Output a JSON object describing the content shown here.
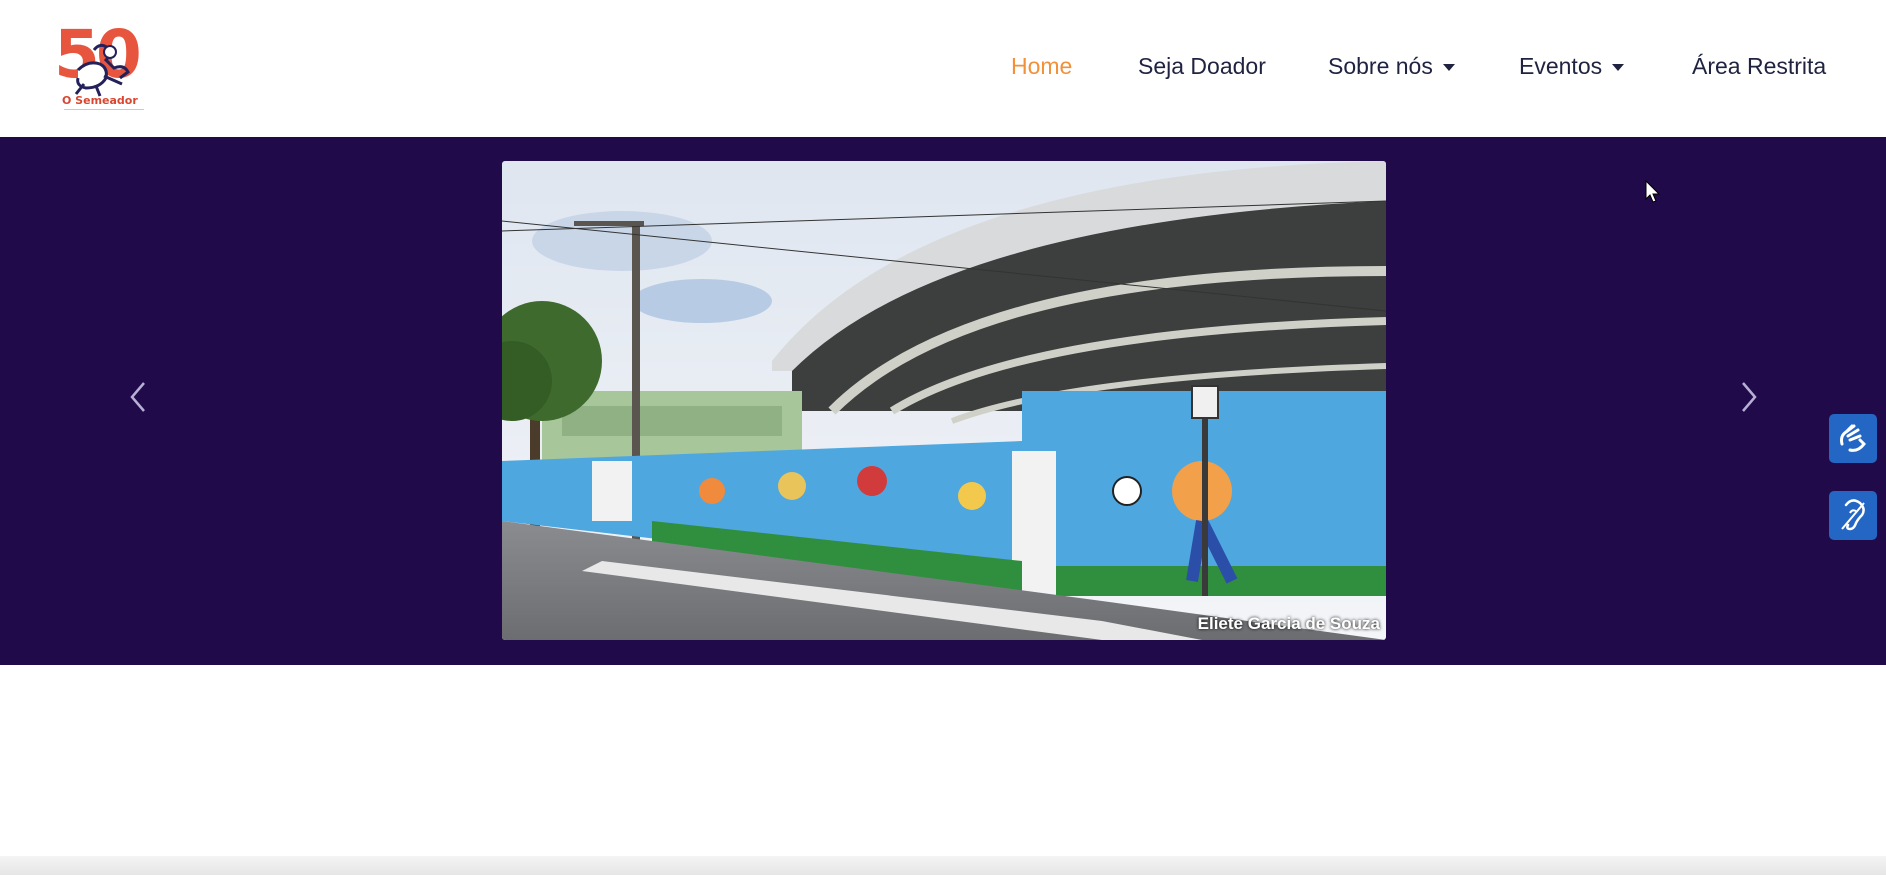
{
  "logo": {
    "number": "50",
    "name": "O Semeador"
  },
  "nav": {
    "items": [
      {
        "label": "Home",
        "active": true,
        "dropdown": false
      },
      {
        "label": "Seja Doador",
        "active": false,
        "dropdown": false
      },
      {
        "label": "Sobre nós",
        "active": false,
        "dropdown": true
      },
      {
        "label": "Eventos",
        "active": false,
        "dropdown": true
      },
      {
        "label": "Área Restrita",
        "active": false,
        "dropdown": false
      }
    ]
  },
  "carousel": {
    "caption": "Eliete Garcia de Souza",
    "prev_icon": "chevron-left-icon",
    "next_icon": "chevron-right-icon"
  },
  "accessibility": {
    "sign_language_icon": "sign-language-hands-icon",
    "hearing_icon": "hearing-assist-icon"
  },
  "colors": {
    "brand": "#e8553e",
    "nav_active": "#f2913a",
    "nav_text": "#1f2340",
    "hero_bg": "#200a4a",
    "accessibility_button": "#2466c3"
  }
}
